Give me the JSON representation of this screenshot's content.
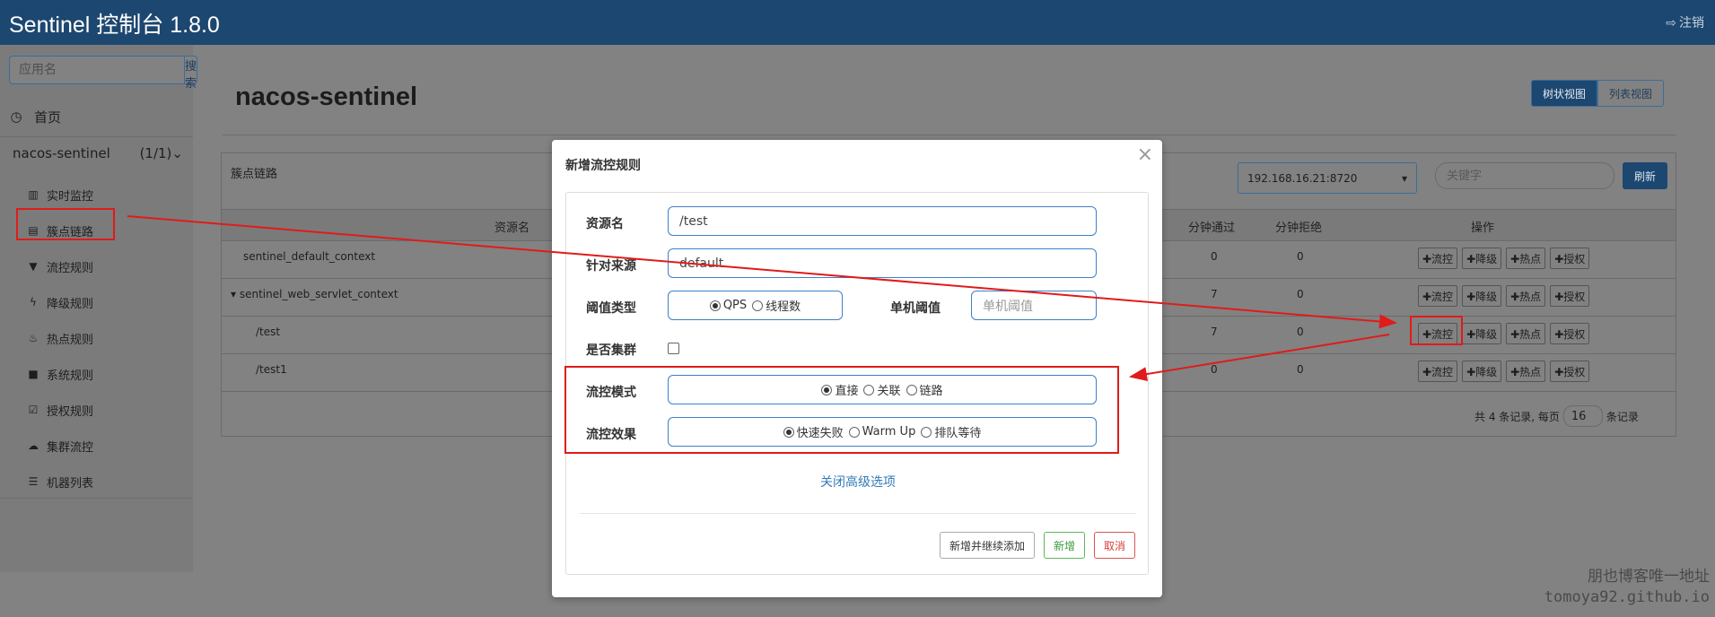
{
  "header": {
    "title": "Sentinel 控制台 1.8.0",
    "logout_icon": "sign-out-icon",
    "logout_label": "注销"
  },
  "sidebar": {
    "search_placeholder": "应用名",
    "search_button": "搜索",
    "home_label": "首页",
    "app_name": "nacos-sentinel",
    "app_count": "(1/1)",
    "items": [
      {
        "label": "实时监控",
        "icon": "bar-chart-icon"
      },
      {
        "label": "簇点链路",
        "icon": "list-icon"
      },
      {
        "label": "流控规则",
        "icon": "filter-icon"
      },
      {
        "label": "降级规则",
        "icon": "bolt-icon"
      },
      {
        "label": "热点规则",
        "icon": "fire-icon"
      },
      {
        "label": "系统规则",
        "icon": "lock-icon"
      },
      {
        "label": "授权规则",
        "icon": "check-square-icon"
      },
      {
        "label": "集群流控",
        "icon": "cloud-icon"
      },
      {
        "label": "机器列表",
        "icon": "th-list-icon"
      }
    ]
  },
  "main": {
    "title": "nacos-sentinel",
    "view_toggle": {
      "tree": "树状视图",
      "list": "列表视图"
    },
    "panel_title": "簇点链路",
    "machine": "192.168.16.21:8720",
    "keyword_placeholder": "关键字",
    "refresh": "刷新",
    "columns": {
      "resource": "资源名",
      "pass": "分钟通过",
      "block": "分钟拒绝",
      "ops": "操作"
    },
    "rows": [
      {
        "name": "sentinel_default_context",
        "pass": "0",
        "block": "0"
      },
      {
        "name": "▾ sentinel_web_servlet_context",
        "pass": "7",
        "block": "0"
      },
      {
        "name": "/test",
        "pass": "7",
        "block": "0"
      },
      {
        "name": "/test1",
        "pass": "0",
        "block": "0"
      }
    ],
    "op_labels": [
      "✚流控",
      "✚降级",
      "✚热点",
      "✚授权"
    ],
    "pager": {
      "prefix": "共 4 条记录, 每页",
      "size": "16",
      "suffix": "条记录"
    }
  },
  "modal": {
    "title": "新增流控规则",
    "resource_label": "资源名",
    "resource_value": "/test",
    "limit_app_label": "针对来源",
    "limit_app_value": "default",
    "grade_label": "阈值类型",
    "grade_options": [
      "QPS",
      "线程数"
    ],
    "grade_selected": "QPS",
    "count_label": "单机阈值",
    "count_placeholder": "单机阈值",
    "cluster_label": "是否集群",
    "strategy_label": "流控模式",
    "strategy_options": [
      "直接",
      "关联",
      "链路"
    ],
    "strategy_selected": "直接",
    "behavior_label": "流控效果",
    "behavior_options": [
      "快速失败",
      "Warm Up",
      "排队等待"
    ],
    "behavior_selected": "快速失败",
    "advanced_link": "关闭高级选项",
    "btn_add_continue": "新增并继续添加",
    "btn_add": "新增",
    "btn_cancel": "取消"
  },
  "watermark": {
    "line1": "朋也博客唯一地址",
    "line2": "tomoya92.github.io"
  },
  "colors": {
    "navbar": "#1c4770",
    "annotation": "#e01b1b",
    "input_border": "#3c80c8"
  }
}
